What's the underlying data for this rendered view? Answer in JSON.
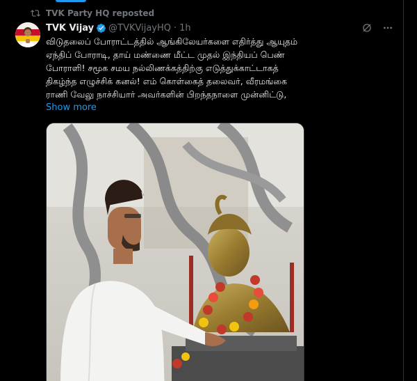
{
  "repost": {
    "label": "TVK Party HQ reposted",
    "icon": "repost-icon"
  },
  "tweet": {
    "author_name": "TVK Vijay",
    "handle": "@TVKVijayHQ",
    "separator": "·",
    "time": "1h",
    "verified_color": "#1d9bf0",
    "text_lines": [
      "விடுதலைப் போராட்டத்தில் ஆங்கிலேயர்களை எதிர்த்து ஆயுதம்",
      "ஏந்திப் போராடி, தாய் மண்ணை மீட்ட முதல் இந்தியப் பெண்",
      "போராளி! சமூக சமய நல்லிணக்கத்திற்கு எடுத்துக்காட்டாகத்",
      "திகழ்ந்த எழுச்சிக் கனல்! எம் கொள்கைத் தலைவர், வீரமங்கை",
      "ராணி வேலு நாச்சியார் அவர்களின் பிறந்தநாளை முன்னிட்டு,"
    ],
    "show_more": "Show more"
  },
  "colors": {
    "background": "#000000",
    "text": "#e7e9ea",
    "muted": "#71767b",
    "accent": "#1d9bf0"
  }
}
